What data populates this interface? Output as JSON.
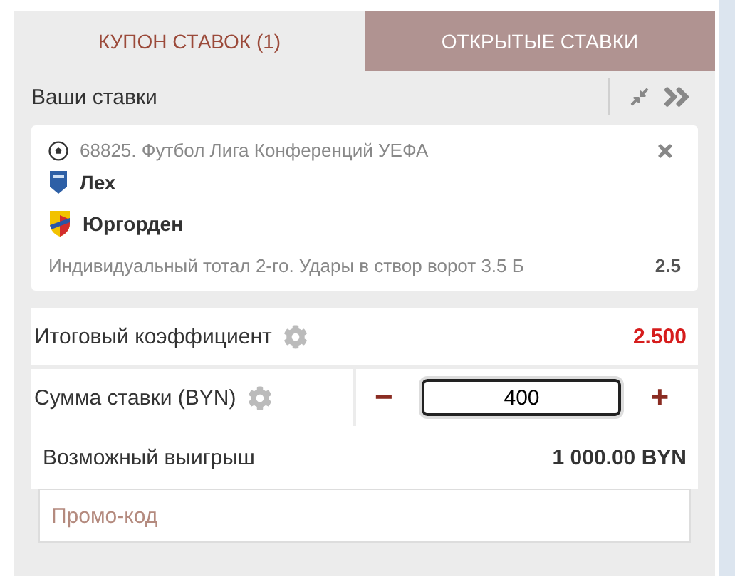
{
  "tabs": [
    {
      "label": "КУПОН СТАВОК (1)",
      "selected": true
    },
    {
      "label": "ОТКРЫТЫЕ СТАВКИ",
      "selected": false
    }
  ],
  "header": {
    "title": "Ваши ставки"
  },
  "bet": {
    "event": "68825. Футбол Лига Конференций УЕФА",
    "teams": [
      {
        "name": "Лех",
        "kind": "pennant"
      },
      {
        "name": "Юргорден",
        "kind": "shield"
      }
    ],
    "market": "Индивидуальный тотал 2-го. Удары в створ ворот 3.5 Б",
    "odds": "2.5"
  },
  "total": {
    "label": "Итоговый коэффициент",
    "value": "2.500"
  },
  "stake": {
    "label": "Сумма ставки (BYN)",
    "minus": "−",
    "value": "400",
    "plus": "+"
  },
  "payout": {
    "label": "Возможный выигрыш",
    "value": "1 000.00 BYN"
  },
  "promo": {
    "placeholder": "Промо-код"
  }
}
